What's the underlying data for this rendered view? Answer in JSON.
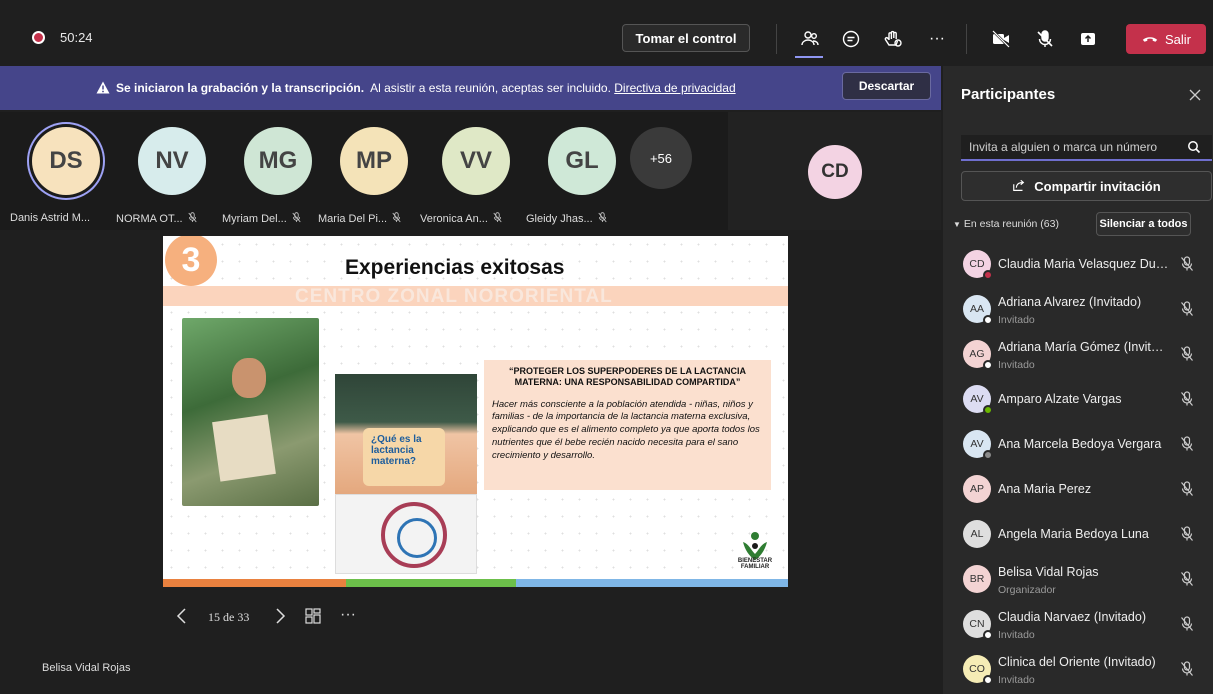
{
  "topbar": {
    "timer": "50:24",
    "take_control_label": "Tomar el control",
    "leave_label": "Salir",
    "more_label": "···",
    "icons": [
      "record-icon",
      "people-icon",
      "chat-icon",
      "reactions-icon",
      "more-icon",
      "camera-off-icon",
      "mic-off-icon",
      "share-icon",
      "phone-hangup-icon"
    ],
    "accent_color": "#8f96f2",
    "leave_color": "#c4314b"
  },
  "banner": {
    "bold_text": "Se iniciaron la grabación y la transcripción.",
    "text": "Al asistir a esta reunión, aceptas ser incluido.",
    "link_text": "Directiva de privacidad",
    "dismiss_label": "Descartar",
    "color": "#45458a"
  },
  "gallery": {
    "tiles": [
      {
        "initials": "DS",
        "name": "Danis Astrid M...",
        "color": "#f7e2bd",
        "muted": false
      },
      {
        "initials": "NV",
        "name": "NORMA OT...",
        "color": "#d7ecec",
        "muted": true
      },
      {
        "initials": "MG",
        "name": "Myriam Del...",
        "color": "#cfe6d5",
        "muted": true
      },
      {
        "initials": "MP",
        "name": "Maria Del Pi...",
        "color": "#f4e3b8",
        "muted": true
      },
      {
        "initials": "VV",
        "name": "Veronica An...",
        "color": "#dfe8c6",
        "muted": true
      },
      {
        "initials": "GL",
        "name": "Gleidy Jhas...",
        "color": "#cfe8d7",
        "muted": true
      }
    ],
    "overflow_label": "+56",
    "pinned_initials": "CD"
  },
  "slide": {
    "number": "3",
    "title": "Experiencias exitosas",
    "subtitle": "CENTRO ZONAL NORORIENTAL",
    "box_title": "“PROTEGER LOS SUPERPODERES DE LA LACTANCIA MATERNA: UNA RESPONSABILIDAD COMPARTIDA”",
    "box_body": "Hacer más consciente a la población atendida - niñas, niños y familias - de la importancia de la lactancia materna exclusiva, explicando que es el alimento completo ya que aporta todos los nutrientes que él bebe recién nacido necesita para el sano crecimiento y desarrollo.",
    "bubble_text": "¿Qué es la lactancia materna?",
    "logo_text": "BIENESTAR FAMILIAR",
    "stripe_colors": [
      "#e9813f",
      "#6cbf4a",
      "#7fb6e6"
    ]
  },
  "stage": {
    "page_indicator": "15 de 33",
    "more_label": "···",
    "presenter_name": "Belisa Vidal Rojas"
  },
  "panel": {
    "title": "Participantes",
    "invite_placeholder": "Invita a alguien o marca un número",
    "share_label": "Compartir invitación",
    "section_label": "En esta reunión (63)",
    "mute_all_label": "Silenciar a todos",
    "participants": [
      {
        "initials": "CD",
        "name": "Claudia Maria Velasquez Duq...",
        "role": "",
        "color": "#f3d3e3",
        "status": "#c4314b"
      },
      {
        "initials": "AA",
        "name": "Adriana Alvarez (Invitado)",
        "role": "Invitado",
        "color": "#d9e6f2",
        "status": "#ffffff"
      },
      {
        "initials": "AG",
        "name": "Adriana María Gómez (Invitad...",
        "role": "Invitado",
        "color": "#f3d3d3",
        "status": "#ffffff"
      },
      {
        "initials": "AV",
        "name": "Amparo Alzate Vargas",
        "role": "",
        "color": "#dcdcf2",
        "status": "#6bb700"
      },
      {
        "initials": "AV",
        "name": "Ana Marcela Bedoya Vergara",
        "role": "",
        "color": "#d9e6f2",
        "status": "#8a8a8a"
      },
      {
        "initials": "AP",
        "name": "Ana Maria Perez",
        "role": "",
        "color": "#f3d3d3",
        "status": ""
      },
      {
        "initials": "AL",
        "name": "Angela Maria Bedoya Luna",
        "role": "",
        "color": "#dedede",
        "status": ""
      },
      {
        "initials": "BR",
        "name": "Belisa Vidal Rojas",
        "role": "Organizador",
        "color": "#f3d3d3",
        "status": ""
      },
      {
        "initials": "CN",
        "name": "Claudia Narvaez (Invitado)",
        "role": "Invitado",
        "color": "#dedede",
        "status": "#ffffff"
      },
      {
        "initials": "CO",
        "name": "Clinica del Oriente (Invitado)",
        "role": "Invitado",
        "color": "#f5ecb5",
        "status": "#ffffff"
      }
    ]
  }
}
